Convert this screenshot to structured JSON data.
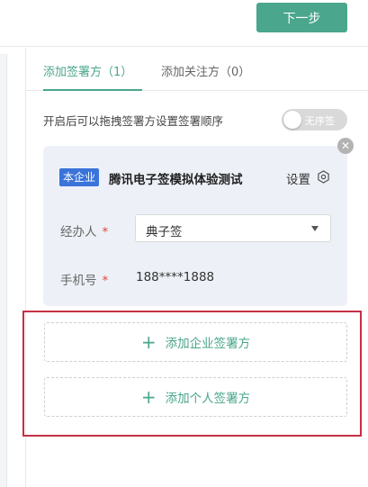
{
  "toolbar": {
    "next_label": "下一步"
  },
  "tabs": [
    {
      "label": "添加签署方（1）",
      "active": true
    },
    {
      "label": "添加关注方（0）",
      "active": false
    }
  ],
  "order": {
    "hint": "开启后可以拖拽签署方设置签署顺序",
    "toggle_label": "无序签",
    "toggle_on": false
  },
  "signer": {
    "badge": "本企业",
    "company": "腾讯电子签模拟体验测试",
    "settings_label": "设置",
    "operator_label": "经办人",
    "operator_value": "典子签",
    "phone_label": "手机号",
    "phone_value": "188****1888",
    "required_mark": "*"
  },
  "actions": {
    "add_company": "添加企业签署方",
    "add_person": "添加个人签署方",
    "plus": "+"
  },
  "colors": {
    "accent": "#4aa68c",
    "badge": "#3a73d9",
    "required": "#e0453a",
    "highlight": "#c62f45"
  }
}
